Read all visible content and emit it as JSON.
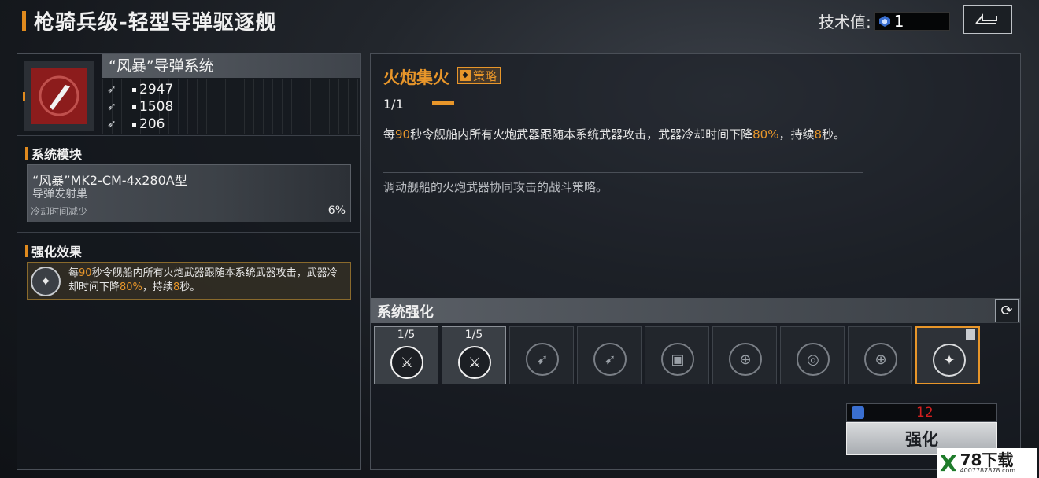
{
  "title": "枪骑兵级-轻型导弹驱逐舰",
  "header": {
    "tech_label": "技术值:",
    "tech_value": "1",
    "back_icon": "back-arrow-icon"
  },
  "weapon": {
    "name": "“风暴”导弹系统",
    "icon": "missile-crosshair-icon",
    "stats": [
      {
        "icon": "damage-icon",
        "value": "2947"
      },
      {
        "icon": "range-icon",
        "value": "1508"
      },
      {
        "icon": "speed-icon",
        "value": "206"
      }
    ]
  },
  "modules": {
    "title": "系统模块",
    "card": {
      "name": "“风暴”MK2-CM-4x280A型",
      "type": "导弹发射巢",
      "effect_label": "冷却时间减少",
      "effect_value": "6%"
    }
  },
  "enhance_effect": {
    "title": "强化效果",
    "text_parts": [
      "每",
      "90",
      "秒令舰船内所有火炮武器跟随本系统武器攻击，武器冷却时间下降",
      "80%",
      "，持续",
      "8",
      "秒。"
    ]
  },
  "skill": {
    "name": "火炮集火",
    "tag": "策略",
    "level": "1/1",
    "desc_parts": [
      "每",
      "90",
      "秒令舰船内所有火炮武器跟随本系统武器攻击，武器冷却时间下降",
      "80%",
      "，持续",
      "8",
      "秒。"
    ],
    "flavor": "调动舰船的火炮武器协同攻击的战斗策略。"
  },
  "upgrades": {
    "title": "系统强化",
    "slots": [
      {
        "level": "1/5",
        "icon": "guns-icon",
        "state": "active"
      },
      {
        "level": "1/5",
        "icon": "guns-icon",
        "state": "active"
      },
      {
        "level": "",
        "icon": "missiles-icon",
        "state": "locked"
      },
      {
        "level": "",
        "icon": "missiles-icon",
        "state": "locked"
      },
      {
        "level": "",
        "icon": "chip-icon",
        "state": "locked"
      },
      {
        "level": "",
        "icon": "target-icon",
        "state": "locked"
      },
      {
        "level": "",
        "icon": "radar-icon",
        "state": "locked"
      },
      {
        "level": "",
        "icon": "target-icon",
        "state": "locked"
      },
      {
        "level": "",
        "icon": "focus-fire-icon",
        "state": "selected"
      }
    ]
  },
  "cost": {
    "value": "12"
  },
  "enhance_button": "强化",
  "watermark": {
    "main": "78下载",
    "sub": "4007787878.com"
  },
  "colors": {
    "accent": "#e8962a",
    "cost": "#d32020"
  }
}
